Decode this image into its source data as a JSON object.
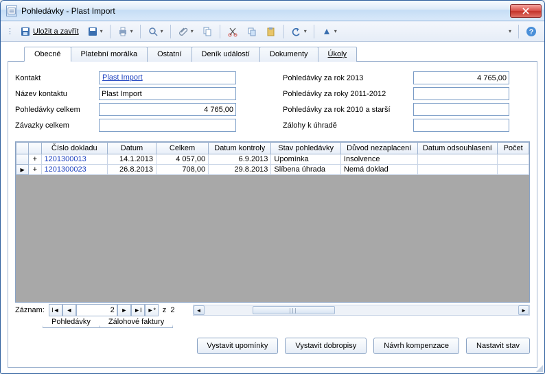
{
  "window": {
    "title": "Pohledávky  - Plast Import"
  },
  "toolbar": {
    "save_close": "Uložit a zavřít"
  },
  "tabs": {
    "items": [
      {
        "label": "Obecné",
        "active": true
      },
      {
        "label": "Platební morálka"
      },
      {
        "label": "Ostatní"
      },
      {
        "label": "Deník událostí"
      },
      {
        "label": "Dokumenty"
      },
      {
        "label": "Úkoly"
      }
    ]
  },
  "form": {
    "left": {
      "kontakt_label": "Kontakt",
      "kontakt_value": "Plast Import",
      "nazev_label": "Název kontaktu",
      "nazev_value": "Plast Import",
      "pohl_celkem_label": "Pohledávky celkem",
      "pohl_celkem_value": "4 765,00",
      "zavazky_label": "Závazky celkem",
      "zavazky_value": ""
    },
    "right": {
      "r2013_label": "Pohledávky za rok 2013",
      "r2013_value": "4 765,00",
      "r2011_2012_label": "Pohledávky za roky 2011-2012",
      "r2011_2012_value": "",
      "r2010_label": "Pohledávky za rok 2010 a starší",
      "r2010_value": "",
      "zalohy_label": "Zálohy k úhradě",
      "zalohy_value": ""
    }
  },
  "grid": {
    "headers": {
      "cislo": "Číslo dokladu",
      "datum": "Datum",
      "celkem": "Celkem",
      "datum_kontroly": "Datum kontroly",
      "stav": "Stav pohledávky",
      "duvod": "Důvod nezaplacení",
      "datum_ods": "Datum odsouhlasení",
      "pocet": "Počet"
    },
    "rows": [
      {
        "selected": false,
        "cislo": "1201300013",
        "datum": "14.1.2013",
        "celkem": "4 057,00",
        "datum_kontroly": "6.9.2013",
        "stav": "Upomínka",
        "duvod": "Insolvence",
        "datum_ods": "",
        "pocet": ""
      },
      {
        "selected": true,
        "cislo": "1201300023",
        "datum": "26.8.2013",
        "celkem": "708,00",
        "datum_kontroly": "29.8.2013",
        "stav": "Slíbena úhrada",
        "duvod": "Nemá doklad",
        "datum_ods": "",
        "pocet": ""
      }
    ]
  },
  "nav": {
    "label": "Záznam:",
    "current": "2",
    "oftext": "z",
    "total": "2"
  },
  "subtabs": {
    "items": [
      {
        "label": "Pohledávky",
        "active": true
      },
      {
        "label": "Zálohové faktury"
      }
    ]
  },
  "buttons": {
    "upominky": "Vystavit upomínky",
    "dobropisy": "Vystavit dobropisy",
    "kompenzace": "Návrh kompenzace",
    "stav": "Nastavit stav"
  }
}
